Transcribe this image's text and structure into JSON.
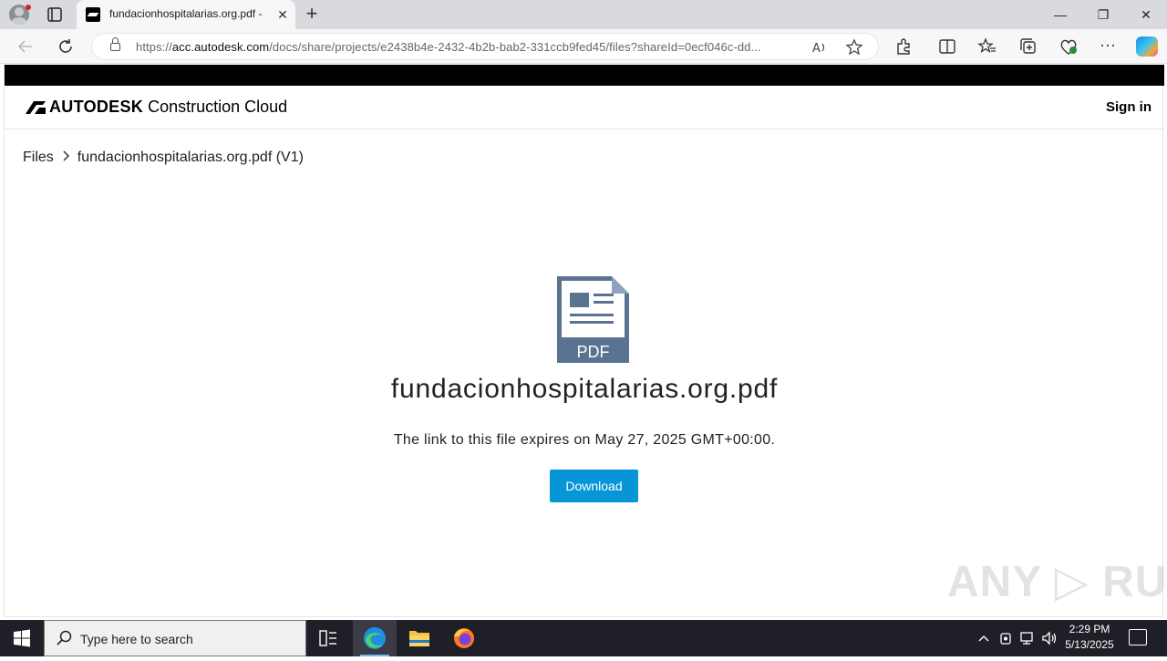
{
  "browser": {
    "tab": {
      "title": "fundacionhospitalarias.org.pdf -",
      "close_glyph": "✕"
    },
    "new_tab_glyph": "+",
    "url": {
      "prefix": "https://",
      "host": "acc.autodesk.com",
      "path": "/docs/share/projects/e2438b4e-2432-4b2b-bab2-331ccb9fed45/files?shareId=0ecf046c-dd..."
    },
    "window_controls": {
      "minimize": "—",
      "restore": "❐",
      "close": "✕"
    }
  },
  "app": {
    "brand_bold": "AUTODESK",
    "brand_rest": " Construction Cloud",
    "sign_in": "Sign in"
  },
  "breadcrumb": {
    "root": "Files",
    "separator": ">",
    "current": "fundacionhospitalarias.org.pdf (V1)"
  },
  "file": {
    "icon_label": "PDF",
    "name": "fundacionhospitalarias.org.pdf",
    "expiry_text": "The link to this file expires on May 27, 2025 GMT+00:00.",
    "download_label": "Download"
  },
  "watermark": "ANY ▷ RUN",
  "colors": {
    "accent_button": "#0696d7",
    "pdf_icon": "#5a7391",
    "taskbar": "#1f1f27"
  },
  "taskbar": {
    "search_placeholder": "Type here to search",
    "time": "2:29 PM",
    "date": "5/13/2025"
  }
}
